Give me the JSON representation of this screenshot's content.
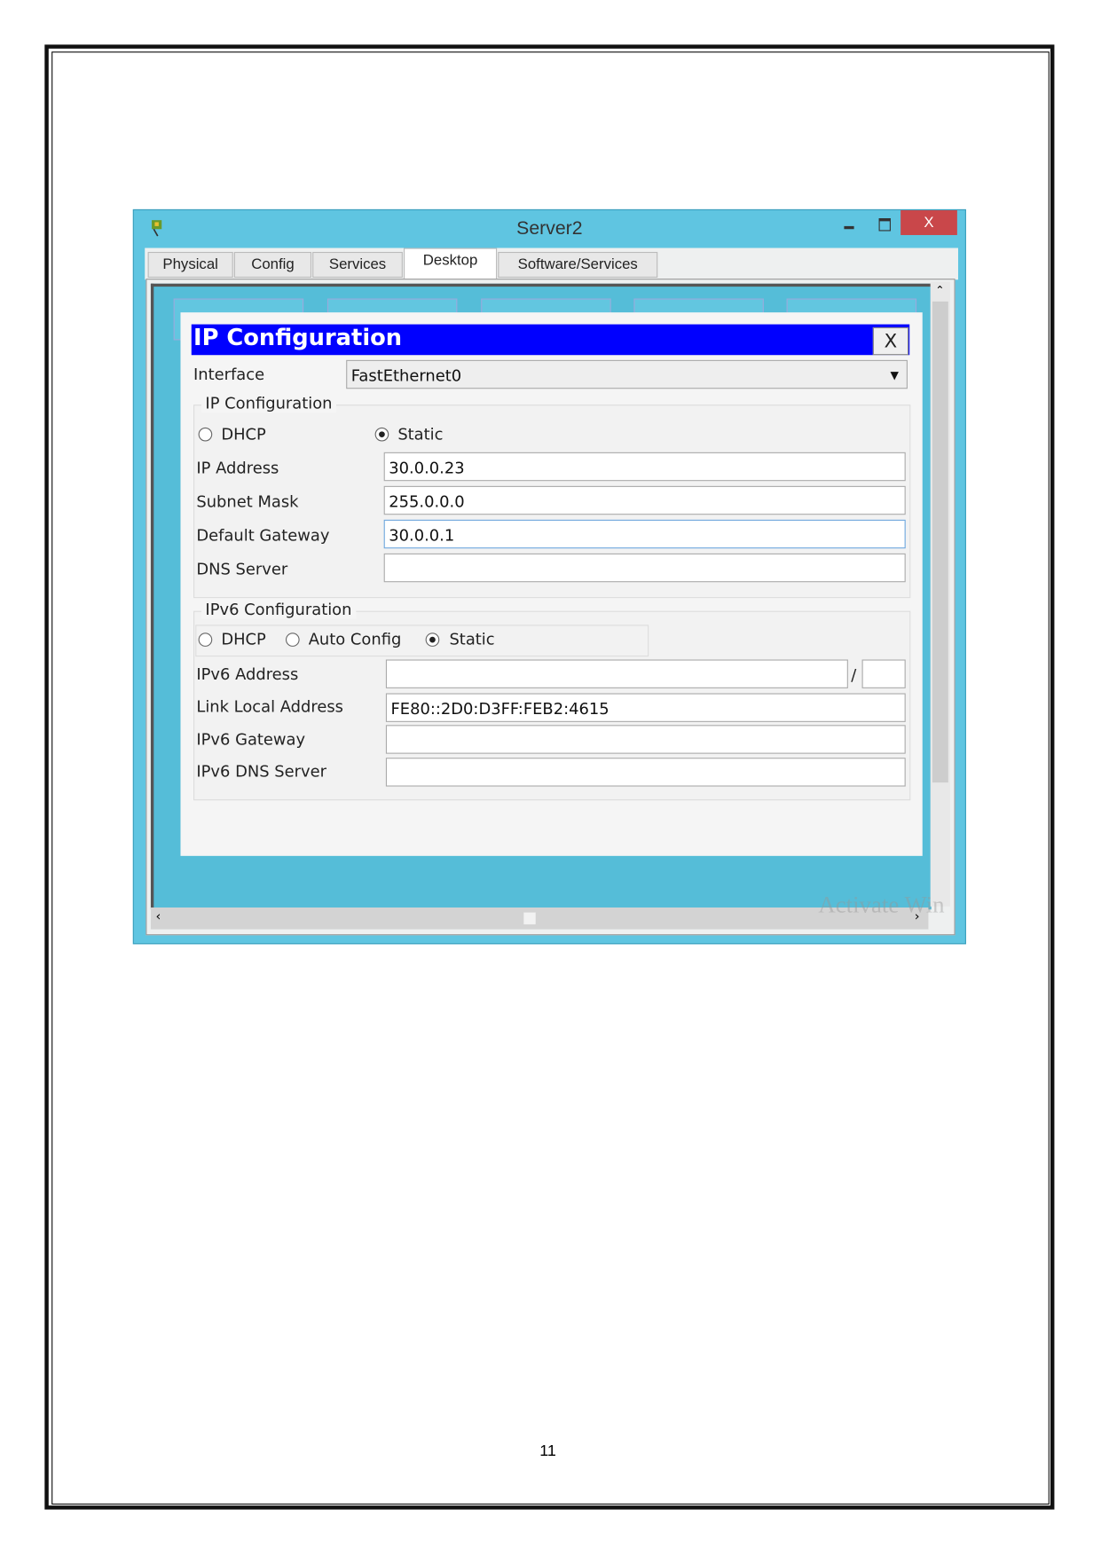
{
  "window": {
    "title": "Server2",
    "close_label": "X"
  },
  "tabs": [
    {
      "label": "Physical"
    },
    {
      "label": "Config"
    },
    {
      "label": "Services"
    },
    {
      "label": "Desktop",
      "active": true
    },
    {
      "label": "Software/Services"
    }
  ],
  "dialog": {
    "title": "IP Configuration",
    "close_label": "X",
    "interface_label": "Interface",
    "interface_value": "FastEthernet0",
    "ipv4": {
      "legend": "IP Configuration",
      "dhcp": "DHCP",
      "static": "Static",
      "selected": "Static",
      "ip_label": "IP Address",
      "ip_value": "30.0.0.23",
      "mask_label": "Subnet Mask",
      "mask_value": "255.0.0.0",
      "gw_label": "Default Gateway",
      "gw_value": "30.0.0.1",
      "dns_label": "DNS Server",
      "dns_value": ""
    },
    "ipv6": {
      "legend": "IPv6 Configuration",
      "dhcp": "DHCP",
      "auto": "Auto Config",
      "static": "Static",
      "selected": "Static",
      "addr_label": "IPv6 Address",
      "addr_value": "",
      "slash": "/",
      "prefix_value": "",
      "link_label": "Link Local Address",
      "link_value": "FE80::2D0:D3FF:FEB2:4615",
      "gw_label": "IPv6 Gateway",
      "gw_value": "",
      "dns_label": "IPv6 DNS Server",
      "dns_value": ""
    }
  },
  "watermark": "Activate Win",
  "page_number": "11",
  "colors": {
    "window_bg": "#5fc5e1",
    "dialog_title": "#0000ff",
    "close_button": "#c9474a"
  }
}
